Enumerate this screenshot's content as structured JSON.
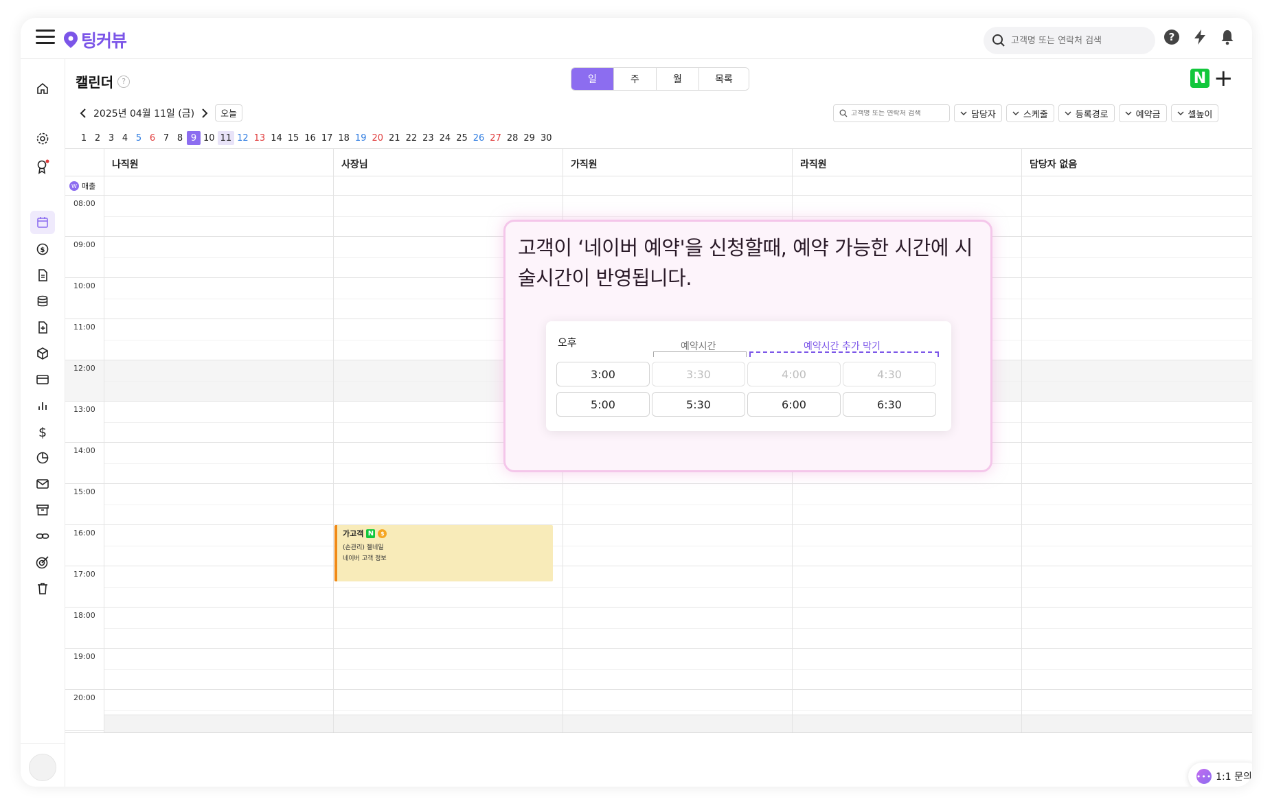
{
  "app": {
    "logo_text": "팅커뷰",
    "brand_color": "#7b55e8",
    "accent_color": "#8c6df0",
    "naver_color": "#12c73c"
  },
  "topbar": {
    "search_placeholder": "고객명 또는 연락처 검색",
    "icons": [
      "menu-icon",
      "search-icon",
      "help-icon",
      "bolt-icon",
      "bell-icon"
    ]
  },
  "sidebar": {
    "items": [
      {
        "icon": "home-icon"
      },
      {
        "icon": "gear-icon"
      },
      {
        "icon": "award-icon",
        "badge": true
      },
      {
        "icon": "calendar-icon",
        "active": true
      },
      {
        "icon": "coin-icon"
      },
      {
        "icon": "document-icon"
      },
      {
        "icon": "database-icon"
      },
      {
        "icon": "file-plus-icon"
      },
      {
        "icon": "box-icon"
      },
      {
        "icon": "card-icon"
      },
      {
        "icon": "bar-chart-icon"
      },
      {
        "icon": "dollar-icon"
      },
      {
        "icon": "pie-chart-icon"
      },
      {
        "icon": "mail-icon"
      },
      {
        "icon": "archive-icon"
      },
      {
        "icon": "link-icon"
      },
      {
        "icon": "target-icon"
      },
      {
        "icon": "trash-icon"
      }
    ]
  },
  "header": {
    "title": "캘린더",
    "help_mark": "?",
    "view_tabs": [
      {
        "label": "일",
        "active": true
      },
      {
        "label": "주"
      },
      {
        "label": "월"
      },
      {
        "label": "목록"
      }
    ],
    "naver_letter": "N",
    "add_symbol": "+"
  },
  "date_nav": {
    "current": "2025년 04월 11일 (금)",
    "today_label": "오늘"
  },
  "filters": {
    "search_placeholder": "고객명 또는 연락처 검색",
    "buttons": [
      "담당자",
      "스케줄",
      "등록경로",
      "예약금",
      "셀높이"
    ]
  },
  "days": [
    {
      "d": "1"
    },
    {
      "d": "2"
    },
    {
      "d": "3"
    },
    {
      "d": "4"
    },
    {
      "d": "5",
      "c": "blue"
    },
    {
      "d": "6",
      "c": "red"
    },
    {
      "d": "7"
    },
    {
      "d": "8"
    },
    {
      "d": "9",
      "c": "selected"
    },
    {
      "d": "10"
    },
    {
      "d": "11",
      "c": "today"
    },
    {
      "d": "12",
      "c": "blue"
    },
    {
      "d": "13",
      "c": "red"
    },
    {
      "d": "14"
    },
    {
      "d": "15"
    },
    {
      "d": "16"
    },
    {
      "d": "17"
    },
    {
      "d": "18"
    },
    {
      "d": "19",
      "c": "blue"
    },
    {
      "d": "20",
      "c": "red"
    },
    {
      "d": "21"
    },
    {
      "d": "22"
    },
    {
      "d": "23"
    },
    {
      "d": "24"
    },
    {
      "d": "25"
    },
    {
      "d": "26",
      "c": "blue"
    },
    {
      "d": "27",
      "c": "red"
    },
    {
      "d": "28"
    },
    {
      "d": "29"
    },
    {
      "d": "30"
    }
  ],
  "calendar": {
    "staff": [
      "나직원",
      "사장님",
      "가직원",
      "라직원",
      "담당자 없음"
    ],
    "sales_label": "매출",
    "sales_badge": "W",
    "hours": [
      "08:00",
      "09:00",
      "10:00",
      "11:00",
      "12:00",
      "13:00",
      "14:00",
      "15:00",
      "16:00",
      "17:00",
      "18:00",
      "19:00",
      "20:00"
    ]
  },
  "appointment": {
    "customer": "가고객",
    "naver_letter": "N",
    "coin_symbol": "$",
    "service": "(손관리) 젤네일",
    "note": "네이버 고객 정보"
  },
  "overlay": {
    "message": "고객이 ‘네이버 예약'을 신청할때, 예약 가능한 시간에 시술시간이 반영됩니다.",
    "period_label": "오후",
    "reserved_label": "예약시간",
    "block_label": "예약시간 추가 막기",
    "slots": [
      {
        "time": "3:00",
        "state": "normal"
      },
      {
        "time": "3:30",
        "state": "muted"
      },
      {
        "time": "4:00",
        "state": "muted"
      },
      {
        "time": "4:30",
        "state": "muted"
      },
      {
        "time": "5:00",
        "state": "normal"
      },
      {
        "time": "5:30",
        "state": "normal"
      },
      {
        "time": "6:00",
        "state": "normal"
      },
      {
        "time": "6:30",
        "state": "normal"
      }
    ]
  },
  "chat": {
    "label": "1:1 문의",
    "icon_text": "•••"
  }
}
